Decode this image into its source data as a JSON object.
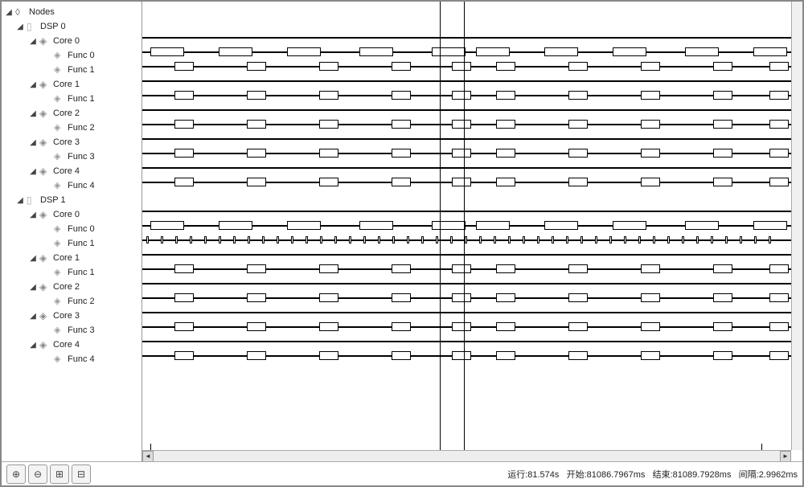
{
  "tree": {
    "root": "Nodes",
    "dsps": [
      {
        "label": "DSP 0",
        "cores": [
          {
            "label": "Core 0",
            "funcs": [
              "Func 0",
              "Func 1"
            ]
          },
          {
            "label": "Core 1",
            "funcs": [
              "Func 1"
            ]
          },
          {
            "label": "Core 2",
            "funcs": [
              "Func 2"
            ]
          },
          {
            "label": "Core 3",
            "funcs": [
              "Func 3"
            ]
          },
          {
            "label": "Core 4",
            "funcs": [
              "Func 4"
            ]
          }
        ]
      },
      {
        "label": "DSP 1",
        "cores": [
          {
            "label": "Core 0",
            "funcs": [
              "Func 0",
              "Func 1"
            ]
          },
          {
            "label": "Core 1",
            "funcs": [
              "Func 1"
            ]
          },
          {
            "label": "Core 2",
            "funcs": [
              "Func 2"
            ]
          },
          {
            "label": "Core 3",
            "funcs": [
              "Func 3"
            ]
          },
          {
            "label": "Core 4",
            "funcs": [
              "Func 4"
            ]
          }
        ]
      }
    ]
  },
  "status": {
    "run_label": "运行:",
    "run_value": "81.574s",
    "start_label": "开始:",
    "start_value": "81086.7967ms",
    "end_label": "结束:",
    "end_value": "81089.7928ms",
    "interval_label": "间隔:",
    "interval_value": "2.9962ms"
  },
  "toolbar": {
    "zoom_in": "zoom-in",
    "zoom_out": "zoom-out",
    "expand": "expand",
    "collapse": "collapse"
  },
  "colors": {
    "border": "#888888",
    "line": "#000000",
    "block_fill": "#ffffff"
  }
}
